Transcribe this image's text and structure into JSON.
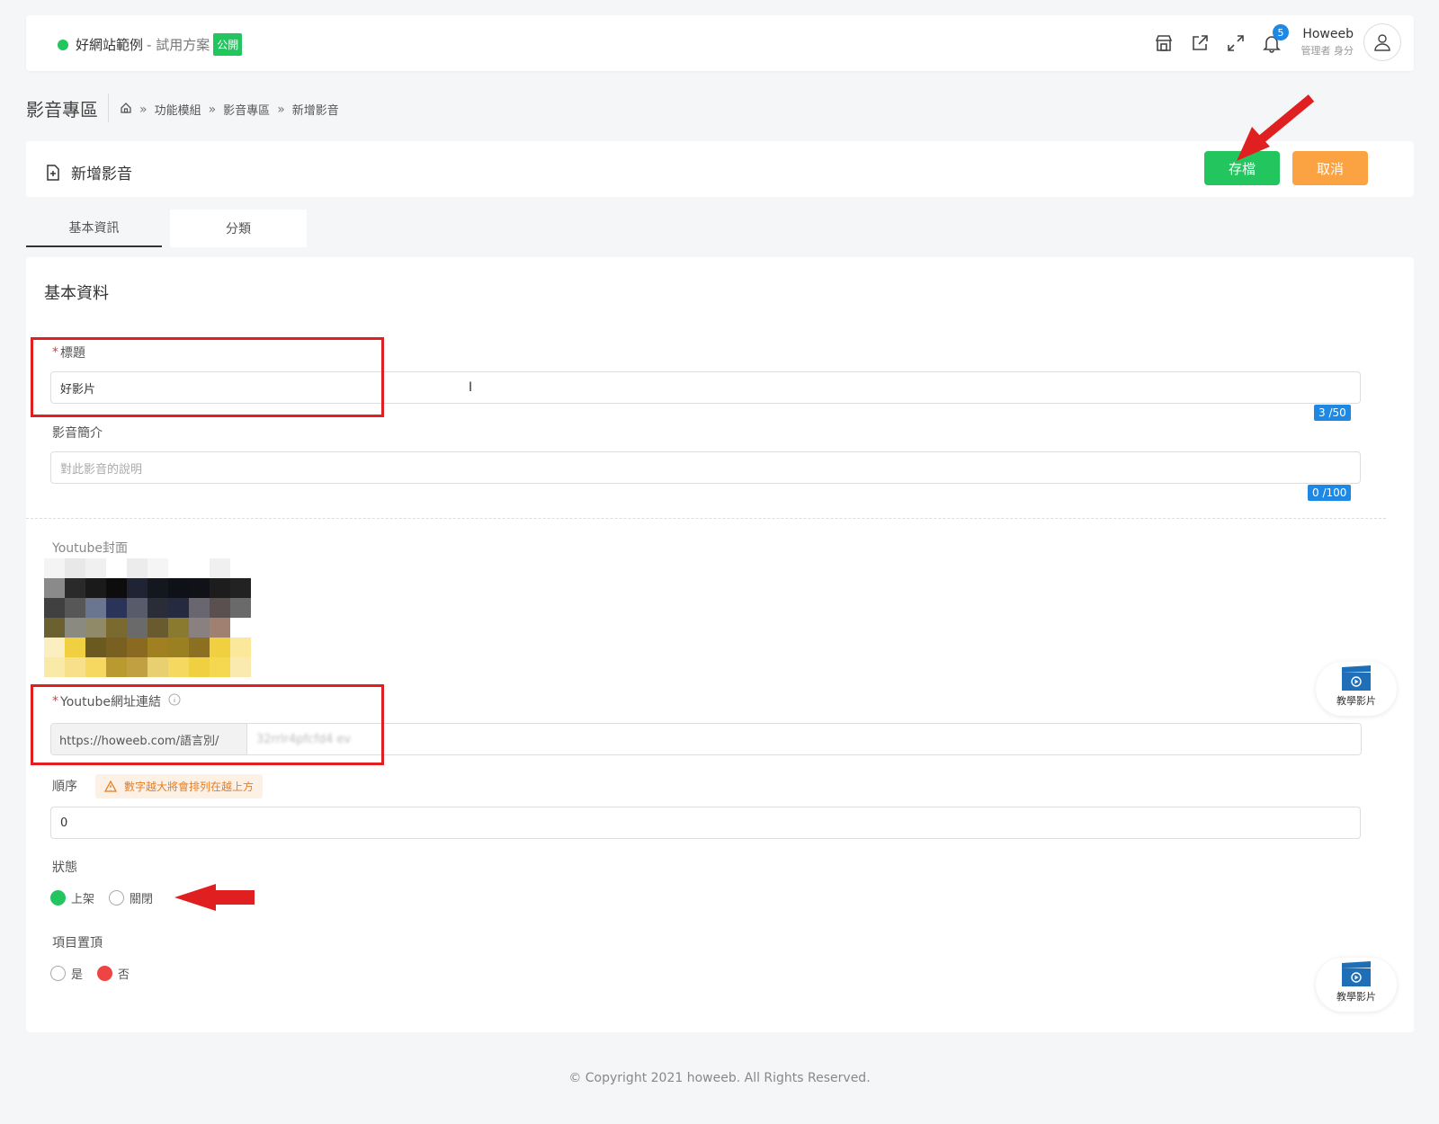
{
  "header": {
    "site_name": "好網站範例",
    "site_plan": "- 試用方案",
    "public_badge": "公開",
    "notification_count": "5",
    "user_name": "Howeeb",
    "user_role": "管理者 身分",
    "icons": [
      "store-icon",
      "external-link-icon",
      "fullscreen-icon",
      "bell-icon",
      "user-icon"
    ]
  },
  "page": {
    "title": "影音專區",
    "breadcrumb": [
      "功能模組",
      "影音專區",
      "新增影音"
    ]
  },
  "form": {
    "title": "新增影音",
    "save_label": "存檔",
    "cancel_label": "取消",
    "tabs": [
      "基本資訊",
      "分類"
    ],
    "section_title": "基本資料",
    "title_label": "標題",
    "title_value": "好影片",
    "title_counter": "3 /50",
    "desc_label": "影音簡介",
    "desc_placeholder": "對此影音的說明",
    "desc_counter": "0 /100",
    "cover_label": "Youtube封面",
    "youtube_label": "Youtube網址連結",
    "youtube_prefix": "https://howeeb.com/語言別/",
    "youtube_value": "32rrlr4pfcfd4 ev",
    "order_label": "順序",
    "order_hint": "數字越大將會排列在越上方",
    "order_value": "0",
    "status_label": "狀態",
    "status_options": [
      "上架",
      "關閉"
    ],
    "status_selected": "上架",
    "pin_label": "項目置頂",
    "pin_options": [
      "是",
      "否"
    ],
    "pin_selected": "否"
  },
  "help": {
    "label": "教學影片"
  },
  "footer": {
    "copyright": "© Copyright 2021 howeeb. All Rights Reserved."
  },
  "colors": {
    "green": "#22c55e",
    "orange": "#fba343",
    "blue": "#1e88e5",
    "red": "#e02020"
  }
}
